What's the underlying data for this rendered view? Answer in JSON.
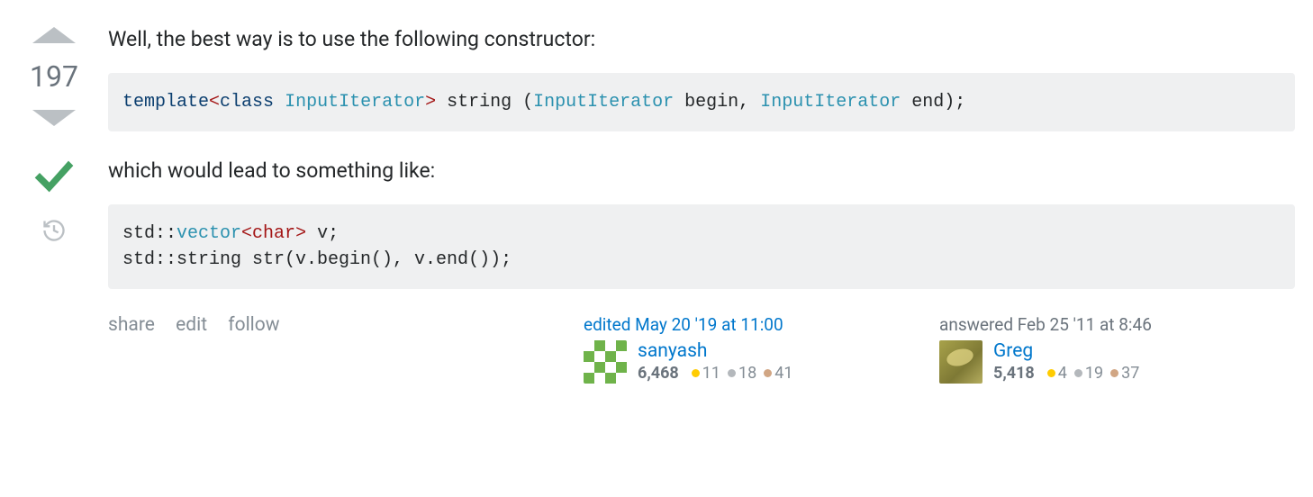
{
  "vote": {
    "score": "197"
  },
  "body": {
    "p1": "Well, the best way is to use the following constructor:",
    "p2": "which would lead to something like:"
  },
  "code1": {
    "t_template": "template",
    "t_lt": "<",
    "t_class": "class",
    "t_space1": " ",
    "t_InputIterator1": "InputIterator",
    "t_gt": ">",
    "t_sig1": " string (",
    "t_InputIterator2": "InputIterator",
    "t_begin": " begin, ",
    "t_InputIterator3": "InputIterator",
    "t_end": " end);"
  },
  "code2": {
    "l1a": "std::",
    "l1b": "vector",
    "l1c": "<",
    "l1d": "char",
    "l1e": ">",
    "l1f": " v;",
    "l2": "std::string str(v.begin(), v.end());"
  },
  "actions": {
    "share": "share",
    "edit": "edit",
    "follow": "follow"
  },
  "editor": {
    "action": "edited May 20 '19 at 11:00",
    "name": "sanyash",
    "rep": "6,468",
    "gold": "11",
    "silver": "18",
    "bronze": "41"
  },
  "answerer": {
    "action": "answered Feb 25 '11 at 8:46",
    "name": "Greg",
    "rep": "5,418",
    "gold": "4",
    "silver": "19",
    "bronze": "37"
  }
}
